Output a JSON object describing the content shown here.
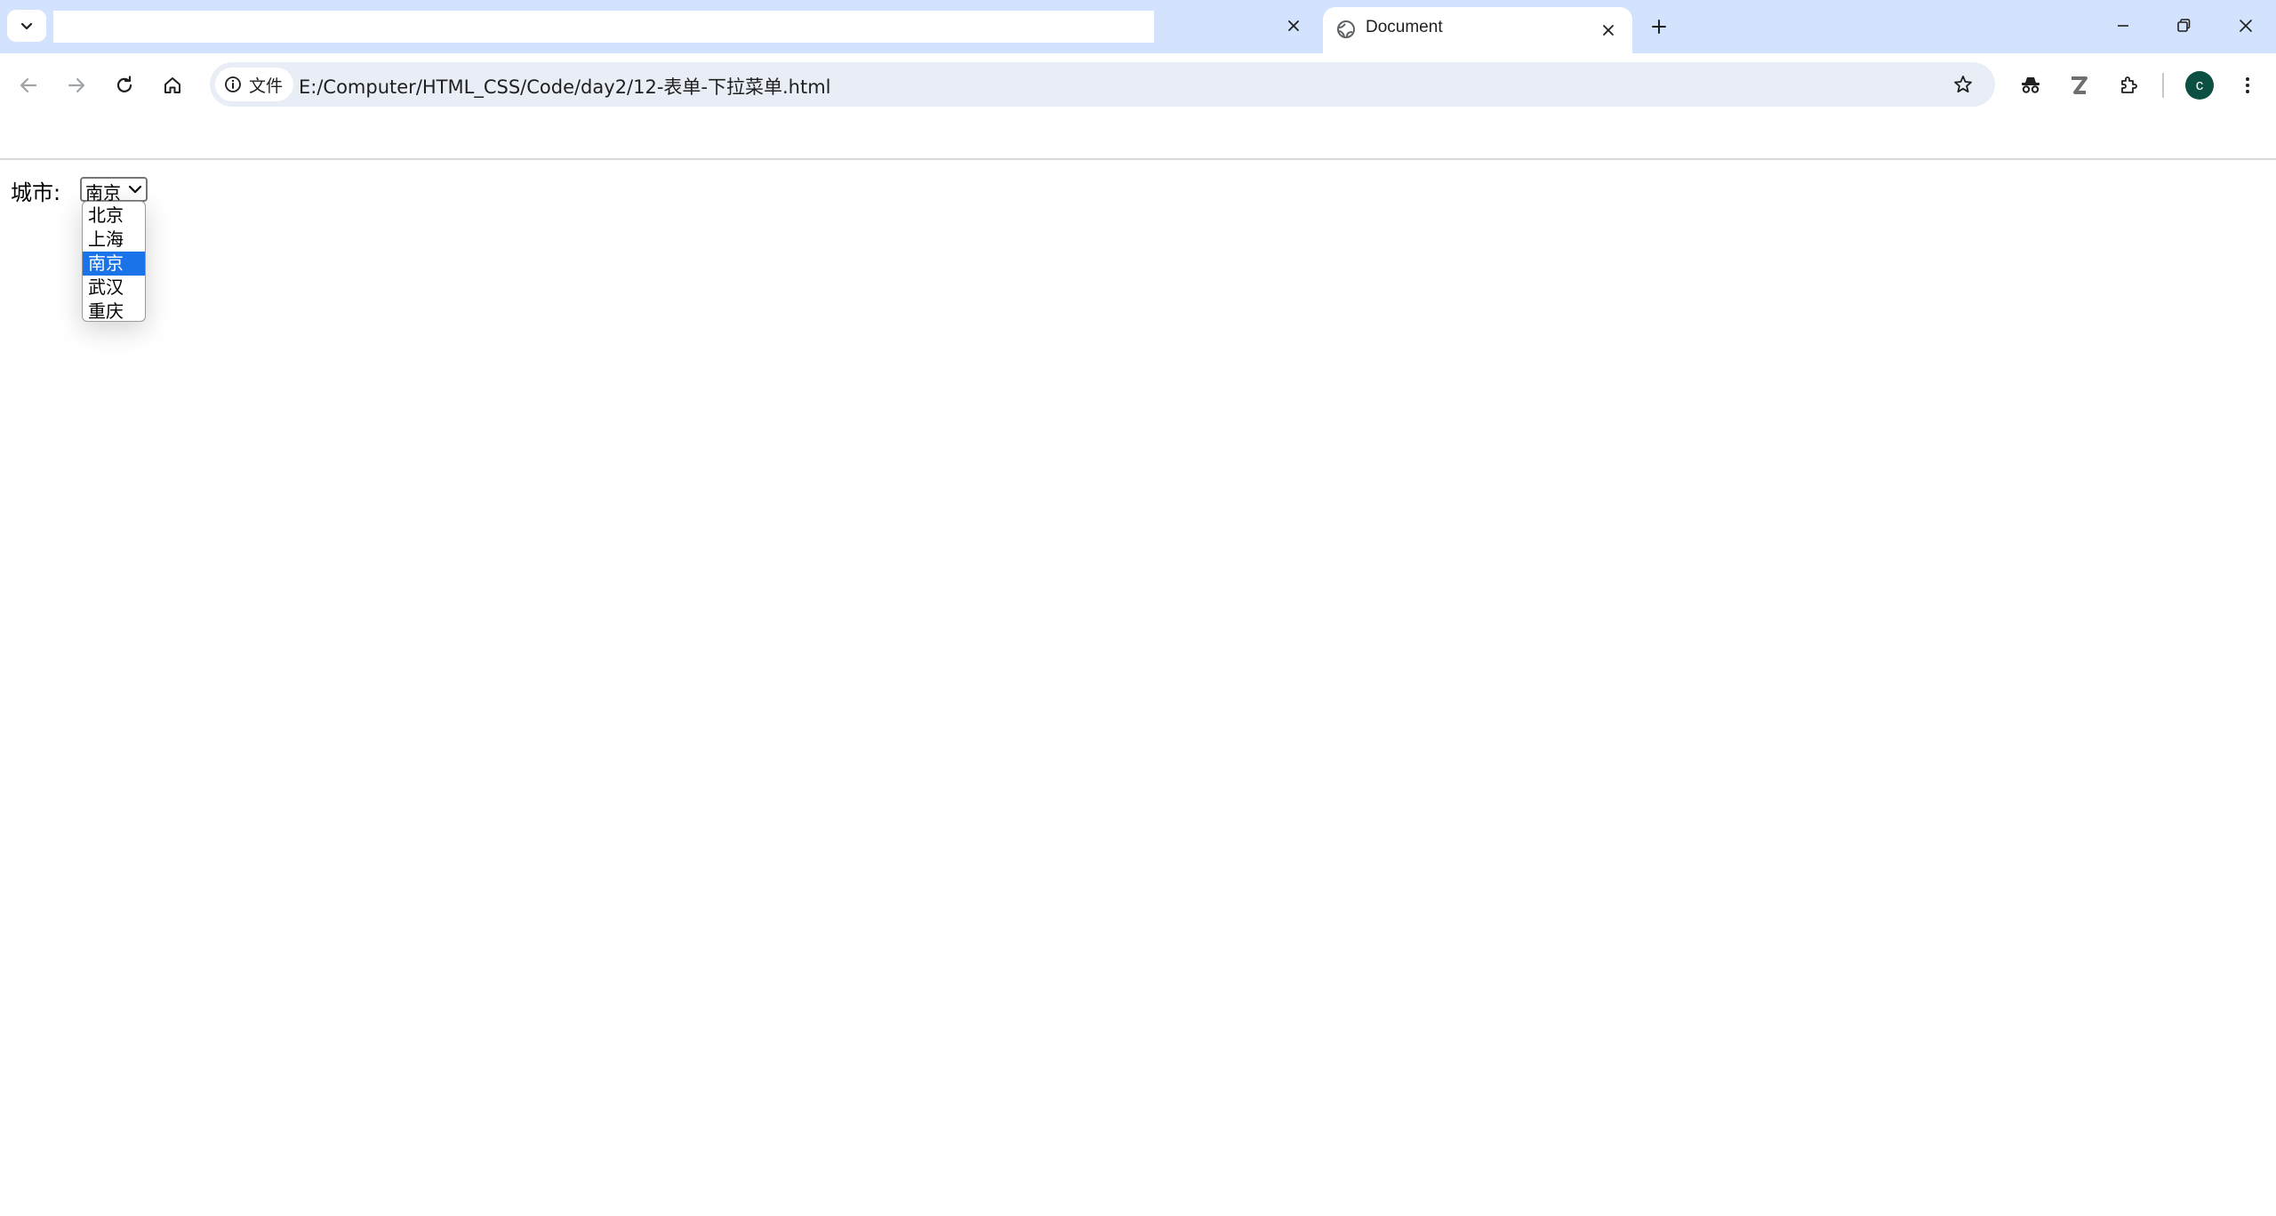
{
  "browser": {
    "tabs": [
      {
        "title": ""
      },
      {
        "title": "Document"
      }
    ],
    "address_chip": "文件",
    "url": "E:/Computer/HTML_CSS/Code/day2/12-表单-下拉菜单.html",
    "profile_initial": "c"
  },
  "page": {
    "city_label": "城市:",
    "select": {
      "selected": "南京",
      "options": [
        "北京",
        "上海",
        "南京",
        "武汉",
        "重庆"
      ]
    }
  },
  "icons": {
    "tab_search": "chevron-down-icon",
    "globe": "globe-icon",
    "back": "arrow-left-icon",
    "forward": "arrow-right-icon",
    "reload": "reload-icon",
    "home": "home-icon",
    "info": "info-icon",
    "bookmark": "star-icon",
    "extension1": "incognito-like-icon",
    "extension2": "z-extension-icon",
    "extensions": "puzzle-icon",
    "menu": "kebab-menu-icon"
  },
  "colors": {
    "tabstrip": "#d3e3fd",
    "omnibox": "#e9eef6",
    "selected_option": "#1a73e8",
    "avatar": "#0b5042"
  }
}
